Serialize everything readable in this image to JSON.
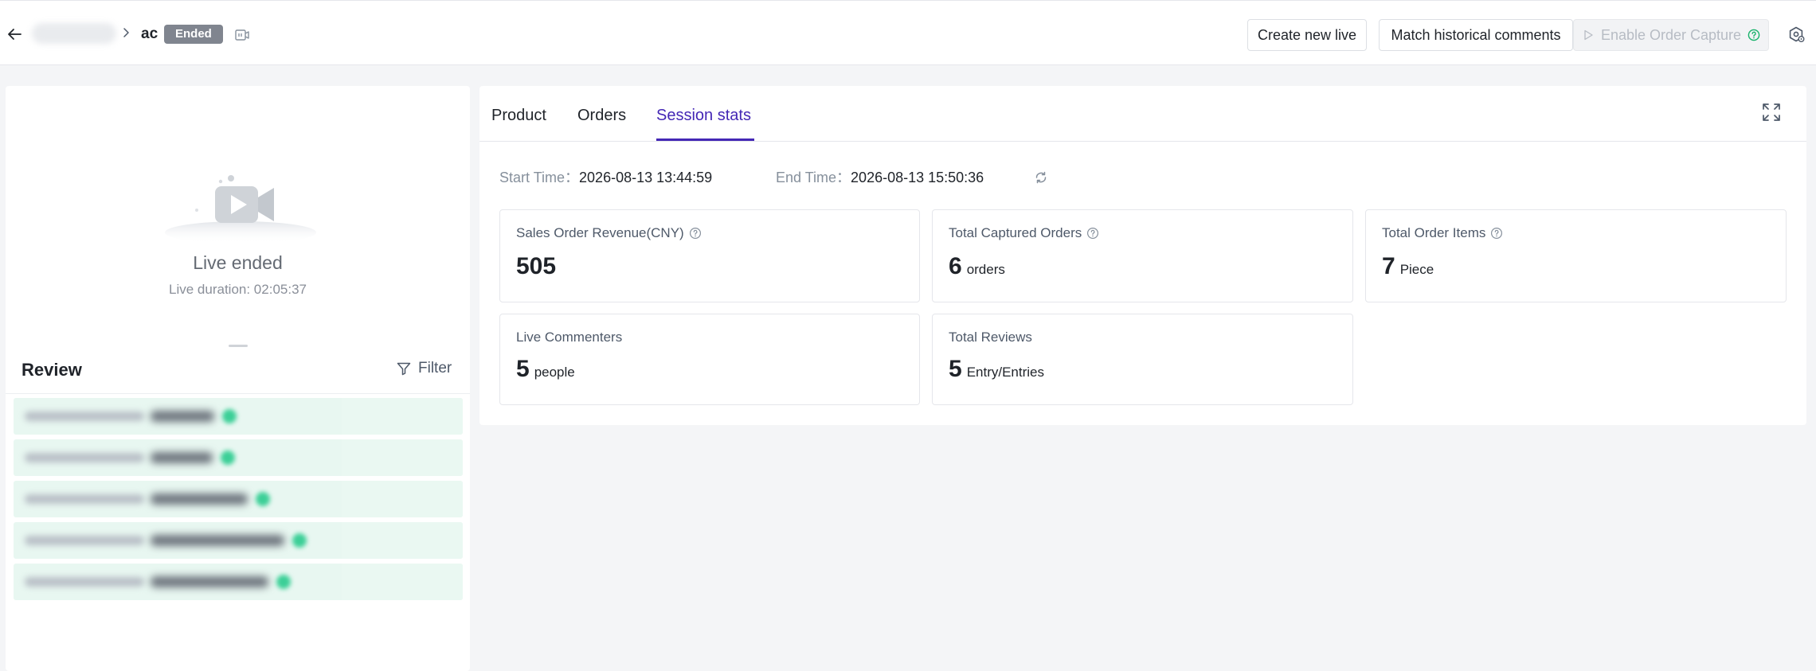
{
  "header": {
    "breadcrumb_current": "ac",
    "status_badge": "Ended",
    "buttons": {
      "create_new_live": "Create new live",
      "match_historical_comments": "Match historical comments",
      "enable_order_capture": "Enable Order Capture"
    }
  },
  "live": {
    "status_title": "Live ended",
    "duration_text": "Live duration: 02:05:37"
  },
  "review": {
    "title": "Review",
    "filter_label": "Filter",
    "item_count": 5
  },
  "tabs": {
    "product": "Product",
    "orders": "Orders",
    "session_stats": "Session stats",
    "active": "Session stats"
  },
  "session": {
    "start_label": "Start Time：",
    "start_value": "2026-08-13 13:44:59",
    "end_label": "End Time：",
    "end_value": "2026-08-13 15:50:36"
  },
  "stats": {
    "sales_revenue": {
      "label": "Sales Order Revenue(CNY)",
      "value": "505",
      "unit": ""
    },
    "captured_orders": {
      "label": "Total Captured Orders",
      "value": "6",
      "unit": "orders"
    },
    "order_items": {
      "label": "Total Order Items",
      "value": "7",
      "unit": "Piece"
    },
    "commenters": {
      "label": "Live Commenters",
      "value": "5",
      "unit": "people"
    },
    "reviews": {
      "label": "Total Reviews",
      "value": "5",
      "unit": "Entry/Entries"
    }
  },
  "colors": {
    "accent": "#4427b5",
    "badge_bg": "#80858f",
    "review_item_bg": "#e8f7f1",
    "help_icon_enabled": "#17b26a"
  },
  "icons": {
    "back": "arrow-left-icon",
    "breadcrumb_separator": "chevron-right-icon",
    "replay": "replay-video-icon",
    "enable_capture": "play-outline-icon",
    "help": "question-circle-icon",
    "settings": "settings-eye-icon",
    "live_ended": "video-camera-illustration",
    "filter": "funnel-icon",
    "fullscreen": "expand-icon",
    "refresh": "refresh-icon"
  }
}
